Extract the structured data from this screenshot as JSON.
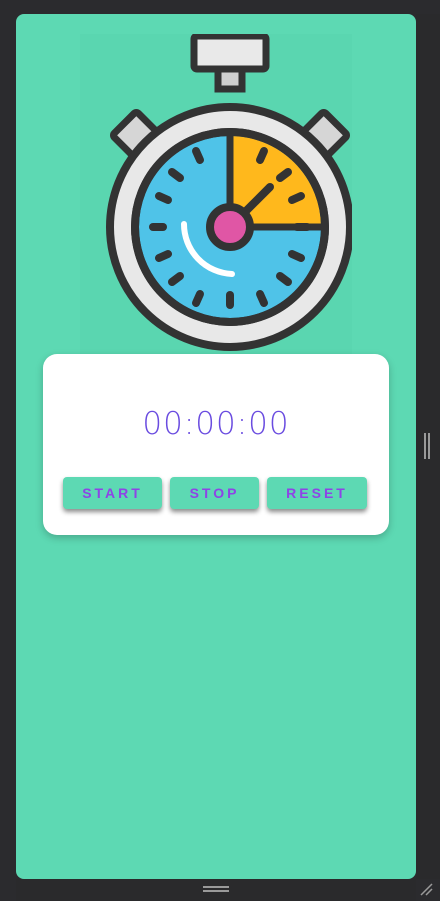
{
  "colors": {
    "background": "#5dd9b3",
    "card": "#ffffff",
    "timer_text": "#6a4ce0",
    "button_text": "#8e44e6",
    "dial_blue": "#4fc3e8",
    "dial_orange": "#ffb81c",
    "center_pink": "#e056a5",
    "outline": "#333333"
  },
  "timer": {
    "display": "00:00:00"
  },
  "controls": {
    "start_label": "START",
    "stop_label": "STOP",
    "reset_label": "RESET"
  },
  "icons": {
    "illustration": "stopwatch-icon",
    "vertical_handle": "drag-handle-icon",
    "horizontal_handle": "drag-handle-icon",
    "corner": "resize-grip-icon"
  }
}
